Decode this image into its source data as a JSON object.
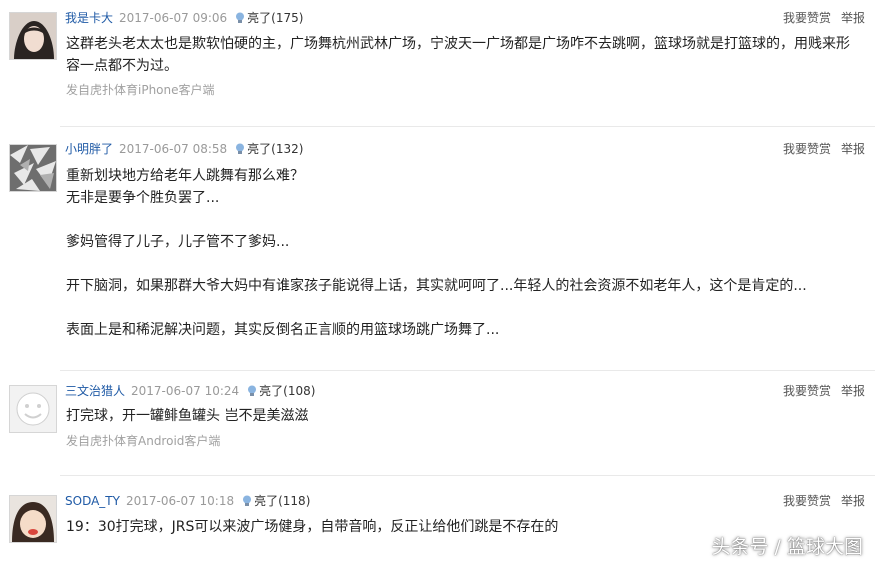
{
  "bulb_color": "#8ab4e0",
  "posts": [
    {
      "user": "我是卡大",
      "date": "2017-06-07 09:06",
      "light_label": "亮了(175)",
      "body_lines": [
        "这群老头老太太也是欺软怕硬的主，广场舞杭州武林广场，宁波天一广场都是广场咋不去跳啊，篮球场就是打篮球的，用贱来形",
        "容一点都不为过。"
      ],
      "source": "发自虎扑体育iPhone客户端"
    },
    {
      "user": "小明胖了",
      "date": "2017-06-07 08:58",
      "light_label": "亮了(132)",
      "body_lines": [
        "重新划块地方给老年人跳舞有那么难？",
        "无非是要争个胜负罢了...",
        "",
        "爹妈管得了儿子，儿子管不了爹妈...",
        "",
        "开下脑洞，如果那群大爷大妈中有谁家孩子能说得上话，其实就呵呵了...年轻人的社会资源不如老年人，这个是肯定的...",
        "",
        "表面上是和稀泥解决问题，其实反倒名正言顺的用篮球场跳广场舞了..."
      ],
      "source": ""
    },
    {
      "user": "三文治猎人",
      "date": "2017-06-07 10:24",
      "light_label": "亮了(108)",
      "body_lines": [
        "打完球，开一罐鲱鱼罐头 岂不是美滋滋"
      ],
      "source": "发自虎扑体育Android客户端"
    },
    {
      "user": "SODA_TY",
      "date": "2017-06-07 10:18",
      "light_label": "亮了(118)",
      "body_lines": [
        "19：30打完球，JRS可以来波广场健身，自带音响，反正让给他们跳是不存在的"
      ],
      "source": ""
    }
  ],
  "actions": {
    "reward": "我要赞赏",
    "report": "举报"
  },
  "watermark": "头条号 / 篮球大图"
}
